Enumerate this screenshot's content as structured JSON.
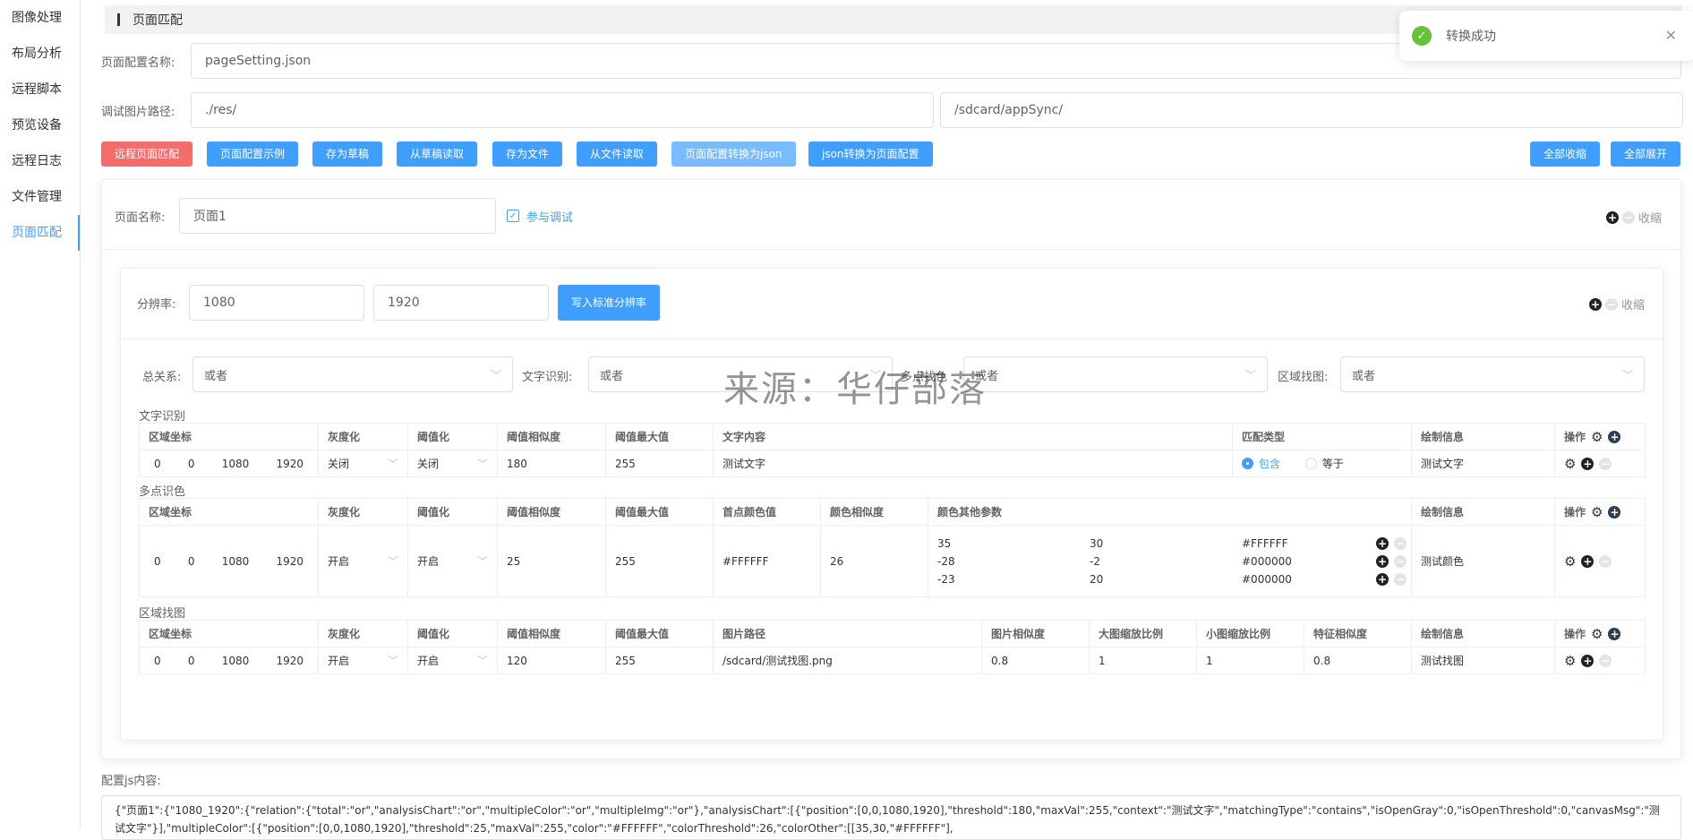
{
  "sidebar": {
    "items": [
      {
        "label": "图像处理"
      },
      {
        "label": "布局分析"
      },
      {
        "label": "远程脚本"
      },
      {
        "label": "预览设备"
      },
      {
        "label": "远程日志"
      },
      {
        "label": "文件管理"
      },
      {
        "label": "页面匹配"
      }
    ],
    "active_index": 6
  },
  "header": {
    "title": "页面匹配"
  },
  "config": {
    "name_label": "页面配置名称:",
    "name_value": "pageSetting.json",
    "path_label": "调试图片路径:",
    "local_path": "./res/",
    "device_path": "/sdcard/appSync/"
  },
  "toolbar": {
    "remote_match": "远程页面匹配",
    "example": "页面配置示例",
    "save_draft": "存为草稿",
    "read_draft": "从草稿读取",
    "save_file": "存为文件",
    "read_file": "从文件读取",
    "to_json": "页面配置转换为json",
    "from_json": "json转换为页面配置",
    "collapse_all": "全部收缩",
    "expand_all": "全部展开"
  },
  "page": {
    "name_label": "页面名称:",
    "name_value": "页面1",
    "debug_label": "参与调试",
    "debug_checked": true,
    "collapse": "收缩"
  },
  "resolution": {
    "label": "分辨率:",
    "width": "1080",
    "height": "1920",
    "write_btn": "写入标准分辨率",
    "collapse": "收缩"
  },
  "relations": {
    "total_label": "总关系:",
    "total_value": "或者",
    "text_label": "文字识别:",
    "text_value": "或者",
    "color_label": "多点找色",
    "color_value": "或者",
    "region_label": "区域找图:",
    "region_value": "或者"
  },
  "text_section": {
    "title": "文字识别",
    "headers": [
      "区域坐标",
      "灰度化",
      "阈值化",
      "阈值相似度",
      "阈值最大值",
      "文字内容",
      "匹配类型",
      "绘制信息",
      "操作"
    ],
    "row": {
      "coords": [
        "0",
        "0",
        "1080",
        "1920"
      ],
      "gray": "关闭",
      "threshold": "关闭",
      "similarity": "180",
      "max": "255",
      "content": "测试文字",
      "match_contains": "包含",
      "match_equals": "等于",
      "draw": "测试文字"
    }
  },
  "color_section": {
    "title": "多点识色",
    "headers": [
      "区域坐标",
      "灰度化",
      "阈值化",
      "阈值相似度",
      "阈值最大值",
      "首点颜色值",
      "颜色相似度",
      "颜色其他参数",
      "绘制信息",
      "操作"
    ],
    "row": {
      "coords": [
        "0",
        "0",
        "1080",
        "1920"
      ],
      "gray": "开启",
      "threshold": "开启",
      "similarity": "25",
      "max": "255",
      "first_color": "#FFFFFF",
      "color_sim": "26",
      "others": [
        {
          "dx": "35",
          "dy": "30",
          "color": "#FFFFFF"
        },
        {
          "dx": "-28",
          "dy": "-2",
          "color": "#000000"
        },
        {
          "dx": "-23",
          "dy": "20",
          "color": "#000000"
        }
      ],
      "draw": "测试颜色"
    }
  },
  "image_section": {
    "title": "区域找图",
    "headers": [
      "区域坐标",
      "灰度化",
      "阈值化",
      "阈值相似度",
      "阈值最大值",
      "图片路径",
      "图片相似度",
      "大图缩放比例",
      "小图缩放比例",
      "特征相似度",
      "绘制信息",
      "操作"
    ],
    "row": {
      "coords": [
        "0",
        "0",
        "1080",
        "1920"
      ],
      "gray": "开启",
      "threshold": "开启",
      "similarity": "120",
      "max": "255",
      "path": "/sdcard/测试找图.png",
      "img_sim": "0.8",
      "big_scale": "1",
      "small_scale": "1",
      "feature_sim": "0.8",
      "draw": "测试找图"
    }
  },
  "js_content": {
    "label": "配置js内容:",
    "text": "{\"页面1\":{\"1080_1920\":{\"relation\":{\"total\":\"or\",\"analysisChart\":\"or\",\"multipleColor\":\"or\",\"multipleImg\":\"or\"},\"analysisChart\":[{\"position\":[0,0,1080,1920],\"threshold\":180,\"maxVal\":255,\"context\":\"测试文字\",\"matchingType\":\"contains\",\"isOpenGray\":0,\"isOpenThreshold\":0,\"canvasMsg\":\"测试文字\"}],\"multipleColor\":[{\"position\":[0,0,1080,1920],\"threshold\":25,\"maxVal\":255,\"color\":\"#FFFFFF\",\"colorThreshold\":26,\"colorOther\":[[35,30,\"#FFFFFF\"],"
  },
  "toast": {
    "message": "转换成功"
  },
  "watermark": "来源：华仔部落",
  "colors": {
    "primary": "#409eff",
    "danger": "#f56c6c",
    "success": "#67c23a"
  }
}
